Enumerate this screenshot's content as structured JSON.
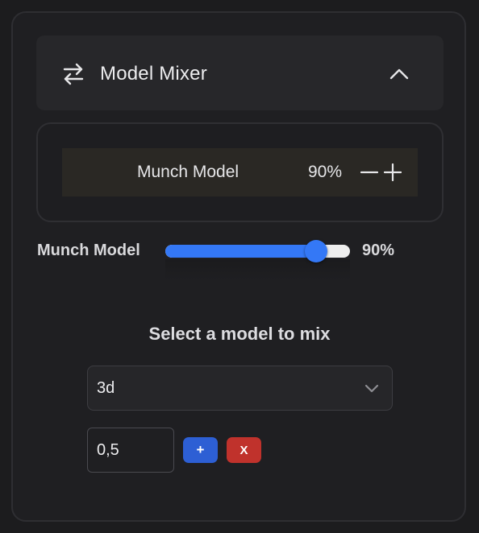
{
  "header": {
    "title": "Model Mixer",
    "icon": "swap-arrows-icon",
    "toggle_icon": "chevron-up-icon"
  },
  "mix_list": [
    {
      "name": "Munch Model",
      "percent": "90%",
      "minus_icon": "minus-icon",
      "plus_icon": "plus-icon"
    }
  ],
  "slider": {
    "label": "Munch Model",
    "value": 90,
    "value_label": "90%",
    "accent": "#3478f6"
  },
  "selector": {
    "title": "Select a model to mix",
    "selected": "3d",
    "chevron_icon": "chevron-down-icon"
  },
  "weight_input": {
    "value": "0,5"
  },
  "buttons": {
    "add_label": "+",
    "add_color": "#2d5fd4",
    "remove_label": "X",
    "remove_color": "#c0322c"
  }
}
